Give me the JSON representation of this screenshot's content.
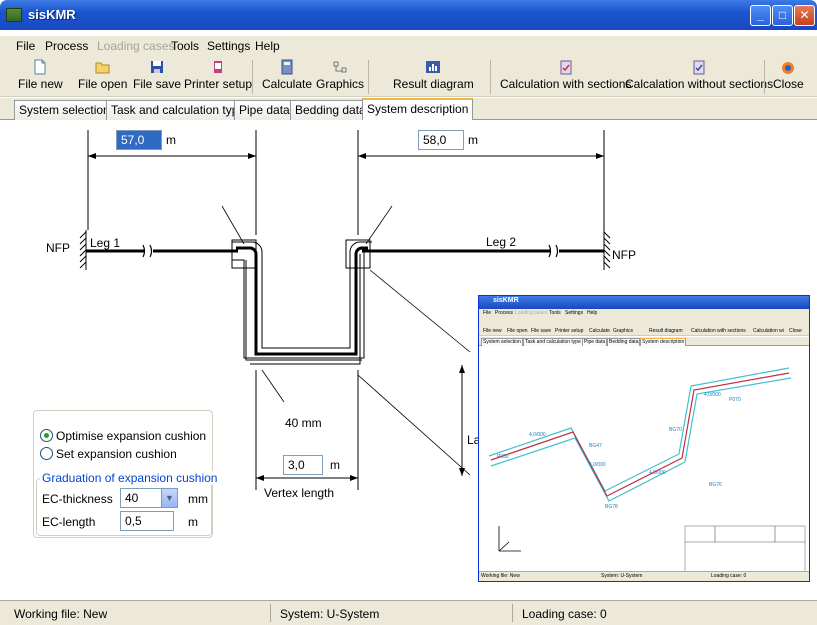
{
  "window": {
    "title": "sisKMR",
    "minimize": "_",
    "maximize": "□",
    "close": "✕"
  },
  "menu": [
    "File",
    "Process",
    "Loading cases",
    "Tools",
    "Settings",
    "Help"
  ],
  "toolbar": {
    "file_new": "File new",
    "file_open": "File open",
    "file_save": "File save",
    "printer_setup": "Printer setup",
    "calculate": "Calculate",
    "graphics": "Graphics",
    "result_diagram": "Result diagram",
    "calc_with_sections": "Calculation with sections",
    "calc_without_sections": "Calcalation without sections",
    "close": "Close"
  },
  "tabs": [
    "System selection",
    "Task and calculation type",
    "Pipe data",
    "Bedding data",
    "System description"
  ],
  "diagram": {
    "leg1_length": "57,0",
    "leg2_length": "58,0",
    "unit_m": "m",
    "nfp_left": "NFP",
    "nfp_right": "NFP",
    "leg1_label": "Leg 1",
    "leg2_label": "Leg 2",
    "cushion_thickness": "40 mm",
    "vertex_length_value": "3,0",
    "vertex_length_label": "Vertex length",
    "lateral_label": "La"
  },
  "options": {
    "optimise_label": "Optimise expansion cushion",
    "set_label": "Set expansion cushion",
    "graduation_legend": "Graduation of expansion cushion",
    "ec_thickness_label": "EC-thickness",
    "ec_thickness_value": "40",
    "ec_thickness_unit": "mm",
    "ec_length_label": "EC-length",
    "ec_length_value": "0,5",
    "ec_length_unit": "m"
  },
  "thumbnail": {
    "title": "sisKMR",
    "menu": [
      "File",
      "Process",
      "Loading cases",
      "Tools",
      "Settings",
      "Help"
    ],
    "toolbar": [
      "File new",
      "File open",
      "File save",
      "Printer setup",
      "Calculate",
      "Graphics",
      "Result diagram",
      "Calculation with sections",
      "Calculation wi",
      "Close"
    ],
    "tabs": [
      "System selection",
      "Task and calculation type",
      "Pipe data",
      "Bedding data",
      "System description"
    ],
    "labels": [
      "P950",
      "BG47",
      "BG76",
      "BG70",
      "P070",
      "BG78",
      "4,0/000",
      "4,0/000",
      "4,0/000",
      "4,0/000"
    ],
    "status": [
      "Working file: New",
      "System: U-System",
      "Loading case: 0"
    ]
  },
  "status": {
    "working_file": "Working file: New",
    "system": "System: U-System",
    "loading_case": "Loading case: 0"
  }
}
